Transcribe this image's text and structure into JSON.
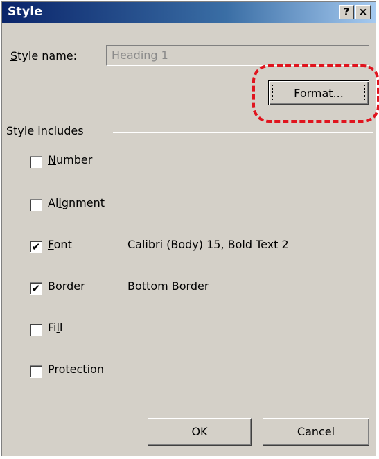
{
  "dialog": {
    "title": "Style",
    "help_glyph": "?",
    "close_glyph": "×"
  },
  "style_name": {
    "label_key": "S",
    "label_rest": "tyle name:",
    "value": "Heading 1"
  },
  "format_button": {
    "before": "F",
    "key": "o",
    "after": "rmat..."
  },
  "group": {
    "label": "Style includes"
  },
  "includes": [
    {
      "before": "",
      "key": "N",
      "after": "umber",
      "checked": false,
      "detail": ""
    },
    {
      "before": "Al",
      "key": "i",
      "after": "gnment",
      "checked": false,
      "detail": ""
    },
    {
      "before": "",
      "key": "F",
      "after": "ont",
      "checked": true,
      "detail": "Calibri (Body) 15, Bold Text 2"
    },
    {
      "before": "",
      "key": "B",
      "after": "order",
      "checked": true,
      "detail": "Bottom Border"
    },
    {
      "before": "Fi",
      "key": "l",
      "after": "l",
      "checked": false,
      "detail": ""
    },
    {
      "before": "Pr",
      "key": "o",
      "after": "tection",
      "checked": false,
      "detail": ""
    }
  ],
  "buttons": {
    "ok": "OK",
    "cancel": "Cancel"
  },
  "check_glyph": "✔",
  "colors": {
    "title_start": "#0a246a",
    "title_end": "#a6caf0",
    "dialog_bg": "#d4d0c8",
    "highlight": "#e0141e"
  }
}
